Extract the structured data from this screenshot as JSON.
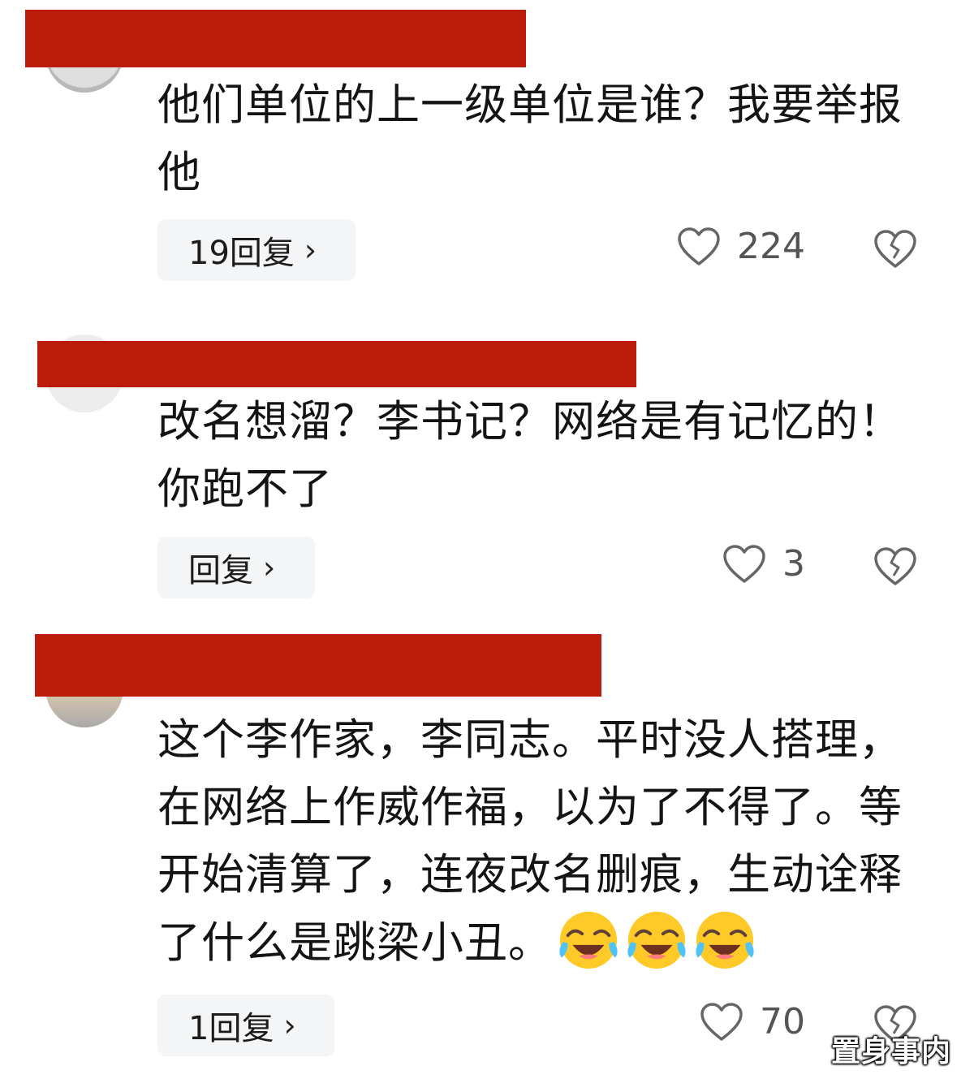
{
  "comments": [
    {
      "text": "他们单位的上一级单位是谁？我要举报他",
      "reply_label": "19回复",
      "likes": "224"
    },
    {
      "text": "改名想溜？李书记？网络是有记忆的！你跑不了",
      "reply_label": "回复",
      "likes": "3"
    },
    {
      "text": "这个李作家，李同志。平时没人搭理，在网络上作威作福，以为了不得了。等开始清算了，连夜改名删痕，生动诠释了什么是跳梁小丑。",
      "reply_label": "1回复",
      "likes": "70"
    }
  ],
  "chevron": "›",
  "watermark": "置身事内",
  "colors": {
    "redaction": "#bb1b0a",
    "reply_bg": "#f4f5f7"
  },
  "icons": [
    "heart-icon",
    "broken-heart-icon",
    "laughing-crying-emoji"
  ]
}
